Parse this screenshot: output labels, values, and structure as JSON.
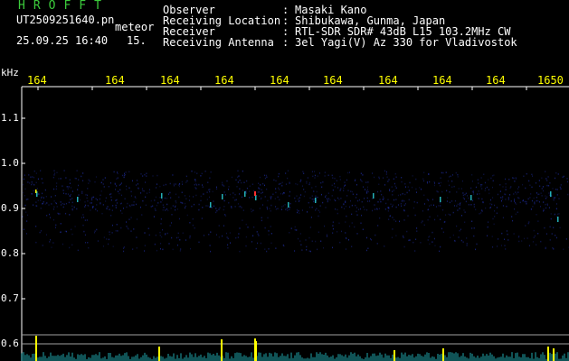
{
  "header": {
    "app_title": "HROFFT",
    "filename": "UT2509251640.pn",
    "tag": "meteor",
    "datetime": "25.09.25 16:40",
    "value": "15.",
    "fields": [
      {
        "key": "Observer",
        "value": "Masaki Kano"
      },
      {
        "key": "Receiving Location",
        "value": "Shibukawa, Gunma, Japan"
      },
      {
        "key": "Receiver",
        "value": "RTL-SDR SDR# 43dB L15 103.2MHz CW"
      },
      {
        "key": "Receiving Antenna",
        "value": "3el Yagi(V) Az 330 for Vladivostok"
      }
    ]
  },
  "axis": {
    "y_unit": "kHz",
    "x_ticks": [
      "164",
      "164",
      "164",
      "164",
      "164",
      "164",
      "164",
      "164",
      "164",
      "1650"
    ],
    "y_ticks": [
      "1.1",
      "1.0",
      "0.9",
      "0.8",
      "0.7",
      "0.6"
    ]
  },
  "colors": {
    "title_green": "#3ccc3c",
    "tick_yellow": "#ffff00",
    "noise_blue": "#1e2c9a",
    "signal_cyan": "#2ad0d8",
    "signal_red": "#ff3030",
    "baseline_gray": "#a0a0a0"
  }
}
